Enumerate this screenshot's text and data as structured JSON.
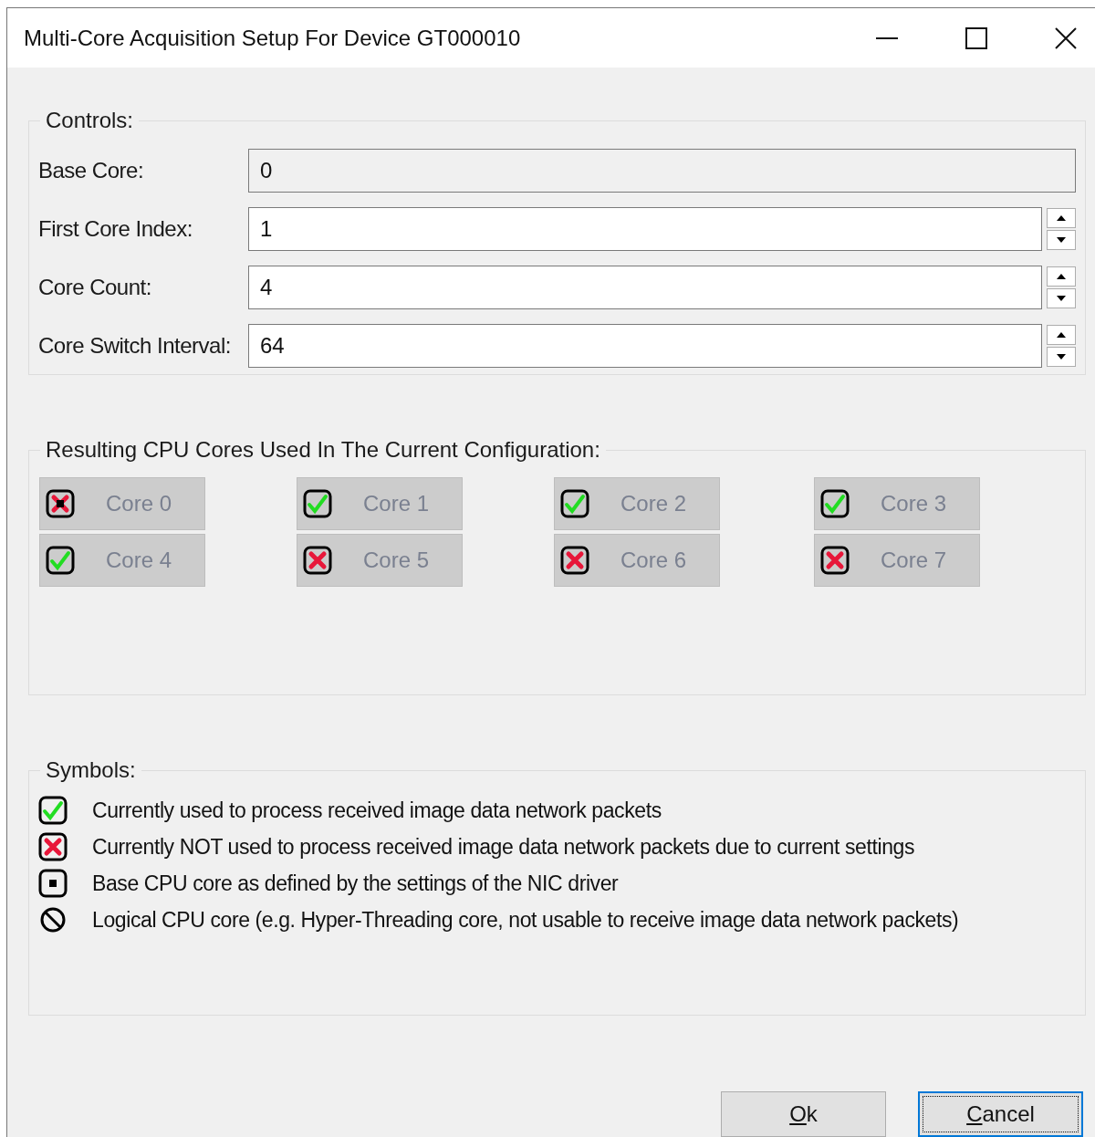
{
  "window": {
    "title": "Multi-Core Acquisition Setup For Device GT000010"
  },
  "controls": {
    "title": "Controls:",
    "fields": [
      {
        "label": "Base Core:",
        "value": "0",
        "disabled": true,
        "spinner": false
      },
      {
        "label": "First Core Index:",
        "value": "1",
        "disabled": false,
        "spinner": true
      },
      {
        "label": "Core Count:",
        "value": "4",
        "disabled": false,
        "spinner": true
      },
      {
        "label": "Core Switch Interval:",
        "value": "64",
        "disabled": false,
        "spinner": true
      }
    ]
  },
  "cores": {
    "title": "Resulting CPU Cores Used In The Current Configuration:",
    "items": [
      {
        "label": "Core 0",
        "kind": "base"
      },
      {
        "label": "Core 1",
        "kind": "used"
      },
      {
        "label": "Core 2",
        "kind": "used"
      },
      {
        "label": "Core 3",
        "kind": "used"
      },
      {
        "label": "Core 4",
        "kind": "used"
      },
      {
        "label": "Core 5",
        "kind": "unused"
      },
      {
        "label": "Core 6",
        "kind": "unused"
      },
      {
        "label": "Core 7",
        "kind": "unused"
      }
    ]
  },
  "symbols": {
    "title": "Symbols:",
    "items": [
      {
        "kind": "used",
        "text": "Currently used to process received image data network packets"
      },
      {
        "kind": "unused",
        "text": "Currently NOT used to process received image data network packets due to current settings"
      },
      {
        "kind": "base",
        "text": "Base CPU core as defined by the settings of the NIC driver"
      },
      {
        "kind": "logical",
        "text": "Logical CPU core (e.g. Hyper-Threading core, not usable to receive image data network packets)"
      }
    ]
  },
  "buttons": [
    {
      "mnemonic": "O",
      "rest": "k",
      "focused": false
    },
    {
      "mnemonic": "C",
      "rest": "ancel",
      "focused": true
    }
  ]
}
